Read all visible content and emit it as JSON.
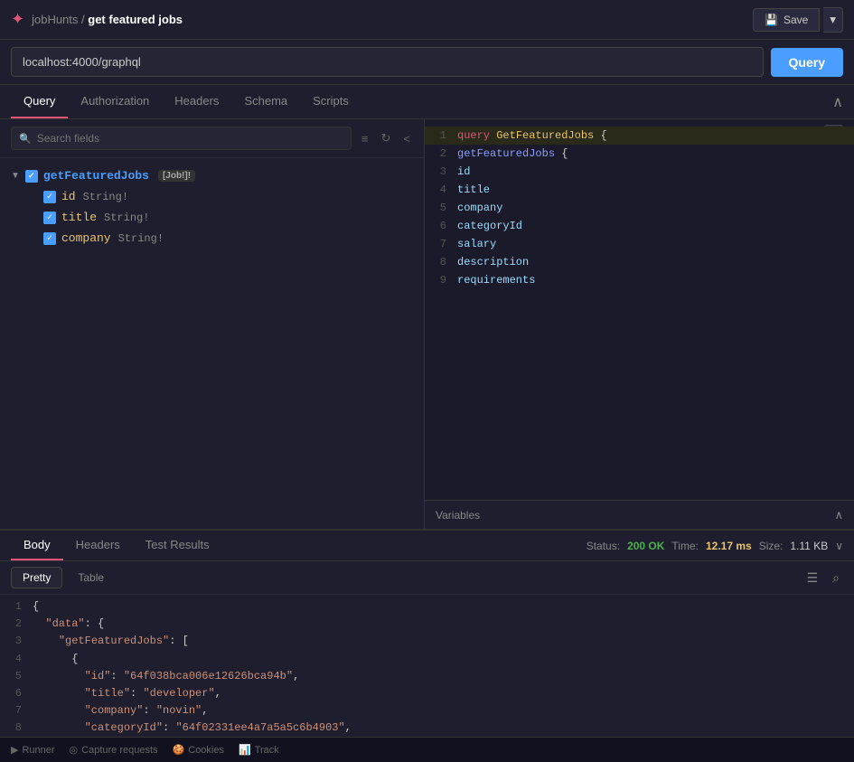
{
  "topBar": {
    "appIcon": "✦",
    "breadcrumb": "jobHunts",
    "separator": "/",
    "currentPage": "get featured jobs",
    "saveLabel": "Save",
    "dropdownIcon": "▾"
  },
  "urlBar": {
    "urlValue": "localhost:4000/graphql",
    "queryButtonLabel": "Query"
  },
  "tabs": {
    "items": [
      "Query",
      "Authorization",
      "Headers",
      "Schema",
      "Scripts"
    ],
    "activeIndex": 0,
    "collapseIcon": "^"
  },
  "leftPanel": {
    "searchPlaceholder": "Search fields",
    "filterIcon": "≡",
    "refreshIcon": "↻",
    "collapseIcon": "<",
    "rootField": {
      "name": "getFeaturedJobs",
      "badge": "[Job!]!",
      "checked": true
    },
    "childFields": [
      {
        "name": "id",
        "type": "String!",
        "checked": true
      },
      {
        "name": "title",
        "type": "String!",
        "checked": true
      },
      {
        "name": "company",
        "type": "String!",
        "checked": true
      }
    ]
  },
  "codeEditor": {
    "lines": [
      {
        "num": 1,
        "text": "query GetFeaturedJobs {",
        "parts": [
          {
            "type": "kw-query",
            "text": "query "
          },
          {
            "type": "kw-name",
            "text": "GetFeaturedJobs "
          },
          {
            "type": "kw-brace",
            "text": "{"
          }
        ]
      },
      {
        "num": 2,
        "text": "    getFeaturedJobs {",
        "parts": [
          {
            "type": "kw-sub",
            "text": "    getFeaturedJobs "
          },
          {
            "type": "kw-brace",
            "text": "{"
          }
        ]
      },
      {
        "num": 3,
        "text": "        id",
        "parts": [
          {
            "type": "kw-field",
            "text": "        id"
          }
        ]
      },
      {
        "num": 4,
        "text": "        title",
        "parts": [
          {
            "type": "kw-field",
            "text": "        title"
          }
        ]
      },
      {
        "num": 5,
        "text": "        company",
        "parts": [
          {
            "type": "kw-field",
            "text": "        company"
          }
        ]
      },
      {
        "num": 6,
        "text": "        categoryId",
        "parts": [
          {
            "type": "kw-field",
            "text": "        categoryId"
          }
        ]
      },
      {
        "num": 7,
        "text": "        salary",
        "parts": [
          {
            "type": "kw-field",
            "text": "        salary"
          }
        ]
      },
      {
        "num": 8,
        "text": "        description",
        "parts": [
          {
            "type": "kw-field",
            "text": "        description"
          }
        ]
      },
      {
        "num": 9,
        "text": "        requirements",
        "parts": [
          {
            "type": "kw-field",
            "text": "        requirements"
          }
        ]
      }
    ],
    "actionsIcon": "{}"
  },
  "variables": {
    "label": "Variables",
    "collapseIcon": "^"
  },
  "bottomPanel": {
    "tabs": [
      "Body",
      "Headers",
      "Test Results"
    ],
    "activeTab": "Body",
    "status": {
      "label": "Status:",
      "code": "200 OK",
      "timeLabel": "Time:",
      "time": "12.17 ms",
      "sizeLabel": "Size:",
      "size": "1.11 KB"
    },
    "formatTabs": [
      "Pretty",
      "Table"
    ],
    "activeFormat": "Pretty",
    "filterIcon": "☰",
    "searchIcon": "⌕",
    "responseLines": [
      {
        "num": 1,
        "content": "{"
      },
      {
        "num": 2,
        "content": "  \"data\": {"
      },
      {
        "num": 3,
        "content": "    \"getFeaturedJobs\": ["
      },
      {
        "num": 4,
        "content": "      {"
      },
      {
        "num": 5,
        "content": "        \"id\": \"64f038bca006e12626bca94b\","
      },
      {
        "num": 6,
        "content": "        \"title\": \"developer\","
      },
      {
        "num": 7,
        "content": "        \"company\": \"novin\","
      },
      {
        "num": 8,
        "content": "        \"categoryId\": \"64f02331ee4a7a5a5c6b4903\","
      }
    ]
  },
  "bottomToolbar": {
    "items": [
      "Runner",
      "Capture requests",
      "Cookies",
      "Track"
    ]
  }
}
